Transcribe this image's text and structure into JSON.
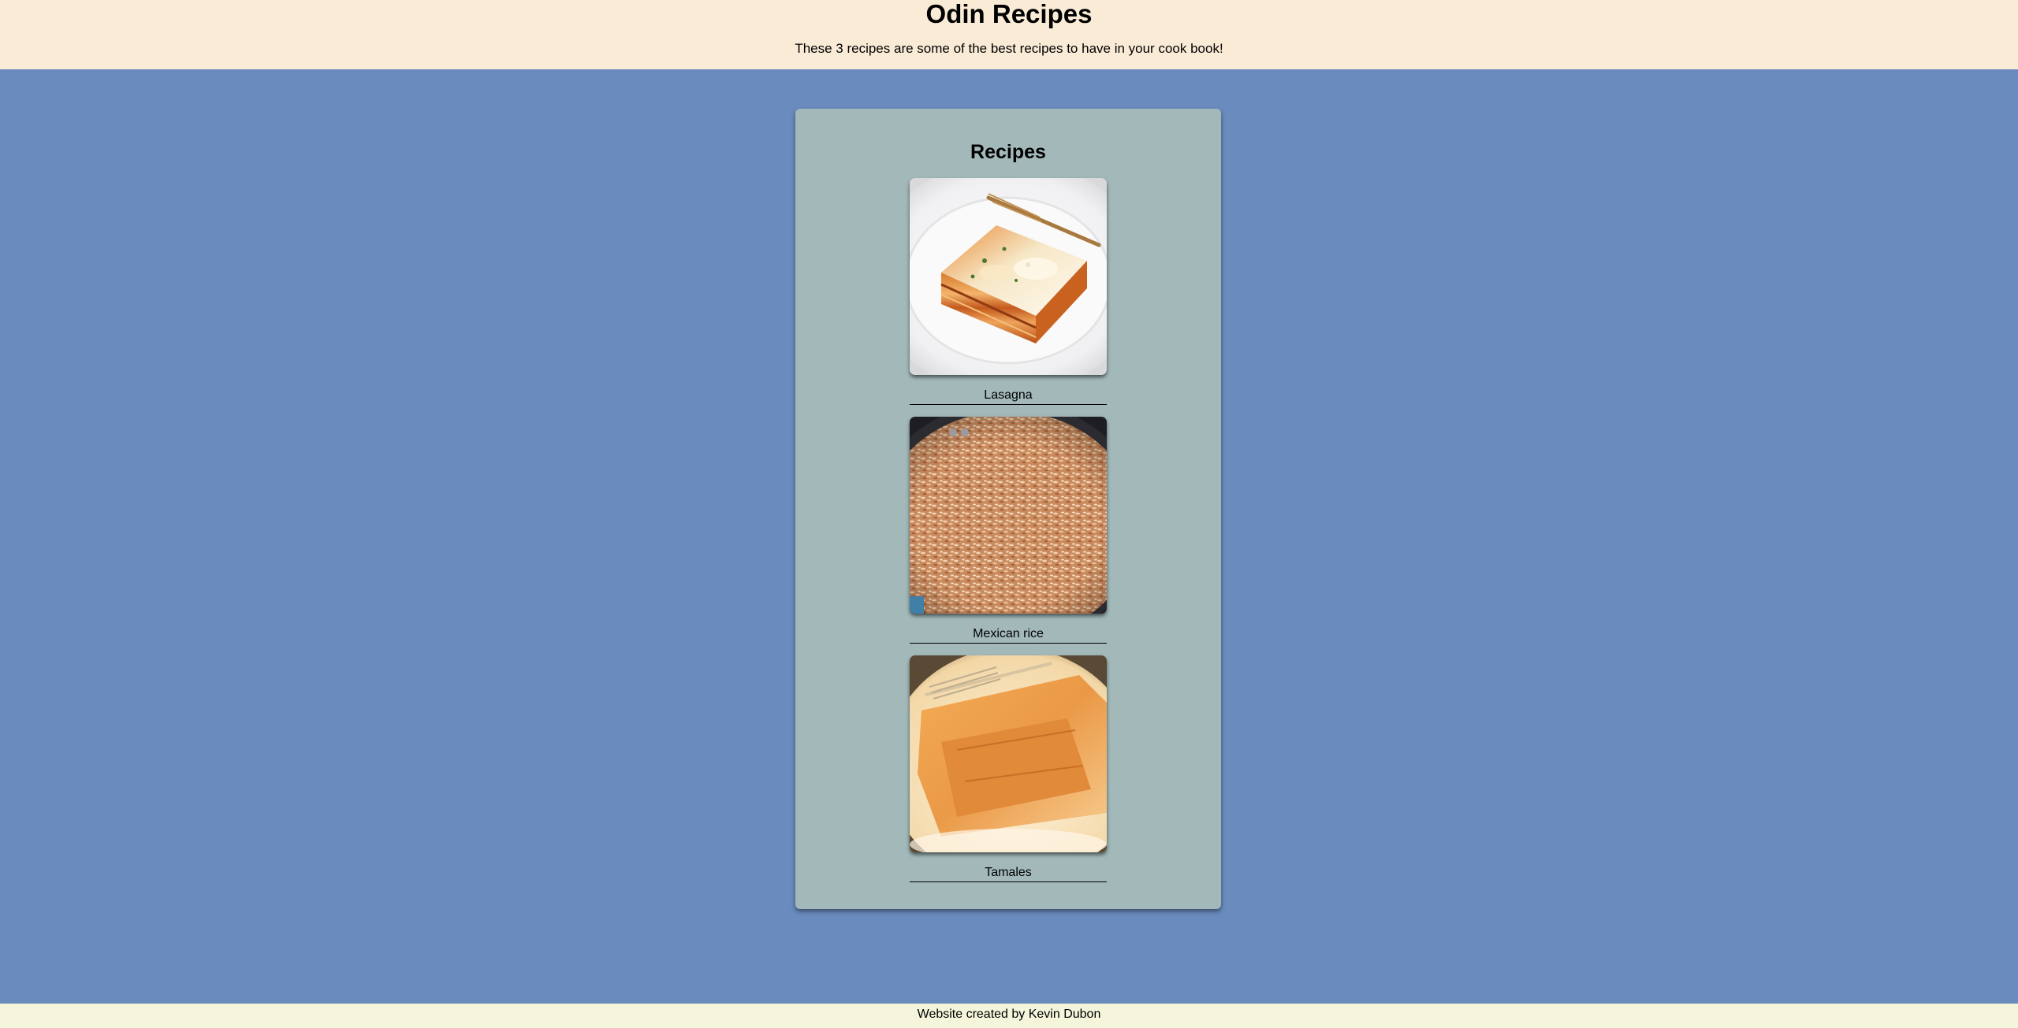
{
  "header": {
    "title": "Odin Recipes",
    "subtitle": "These 3 recipes are some of the best recipes to have in your cook book!"
  },
  "main": {
    "heading": "Recipes",
    "recipes": [
      {
        "name": "Lasagna",
        "image": "lasagna-photo"
      },
      {
        "name": "Mexican rice",
        "image": "mexican-rice-photo"
      },
      {
        "name": "Tamales",
        "image": "tamales-photo"
      }
    ]
  },
  "footer": {
    "prefix": "Website created by ",
    "author": "Kevin Dubon"
  },
  "colors": {
    "page_background": "#6a8bbd",
    "header_background": "#faebd7",
    "card_background": "#a2b8b9",
    "footer_background": "#f5f5dc"
  }
}
